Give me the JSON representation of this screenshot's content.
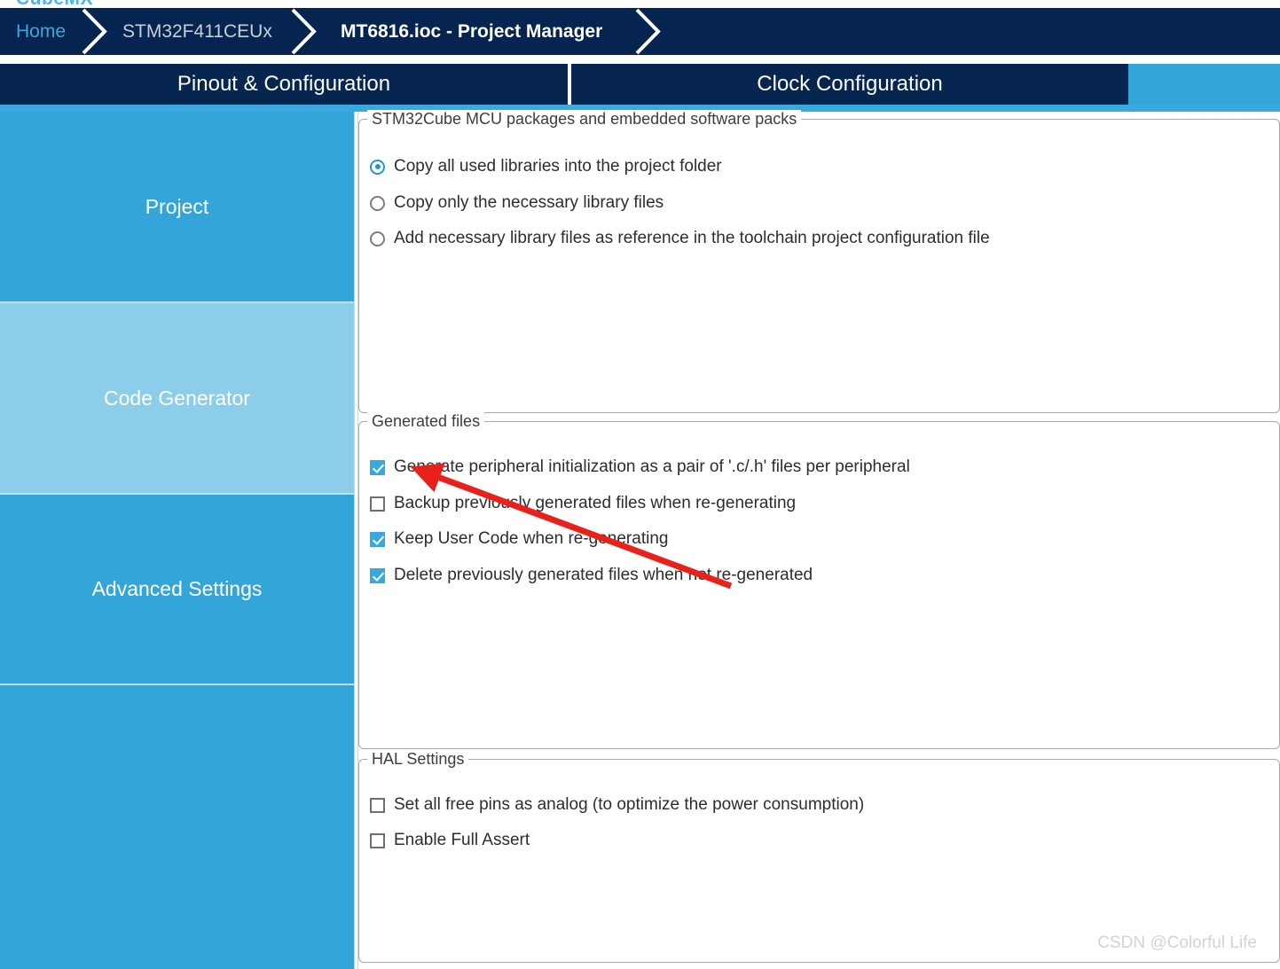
{
  "app": {
    "logo_text": "CubeMX",
    "logo_color": "#4fb3e8"
  },
  "breadcrumb": {
    "items": [
      {
        "label": "Home",
        "style": "link"
      },
      {
        "label": "STM32F411CEUx",
        "style": "normal"
      },
      {
        "label": "MT6816.ioc - Project Manager",
        "style": "current"
      }
    ]
  },
  "tabs": [
    {
      "label": "Pinout & Configuration",
      "active": false
    },
    {
      "label": "Clock Configuration",
      "active": false
    }
  ],
  "sidebar": {
    "items": [
      {
        "label": "Project",
        "selected": false
      },
      {
        "label": "Code Generator",
        "selected": true
      },
      {
        "label": "Advanced Settings",
        "selected": false
      }
    ]
  },
  "groups": {
    "packages": {
      "title": "STM32Cube MCU packages and embedded software packs",
      "options": [
        {
          "label": "Copy all used libraries into the project folder",
          "checked": true
        },
        {
          "label": "Copy only the necessary library files",
          "checked": false
        },
        {
          "label": "Add necessary library files as reference in the toolchain project configuration file",
          "checked": false
        }
      ]
    },
    "generated_files": {
      "title": "Generated files",
      "options": [
        {
          "label": "Generate peripheral initialization as a pair of '.c/.h' files per peripheral",
          "checked": true
        },
        {
          "label": "Backup previously generated files when re-generating",
          "checked": false
        },
        {
          "label": "Keep User Code when re-generating",
          "checked": true
        },
        {
          "label": "Delete previously generated files when not re-generated",
          "checked": true
        }
      ]
    },
    "hal_settings": {
      "title": "HAL Settings",
      "options": [
        {
          "label": "Set all free pins as analog (to optimize the power consumption)",
          "checked": false
        },
        {
          "label": "Enable Full Assert",
          "checked": false
        }
      ]
    }
  },
  "annotation": {
    "arrow_color": "#e8211b",
    "target": "generate-peripheral-init-checkbox"
  },
  "watermark": {
    "text": "CSDN @Colorful   Life"
  },
  "colors": {
    "navy": "#05244f",
    "accent_blue": "#33a5d8",
    "selected_sidebar": "#8ccdea",
    "link_blue": "#3ea6dd"
  }
}
